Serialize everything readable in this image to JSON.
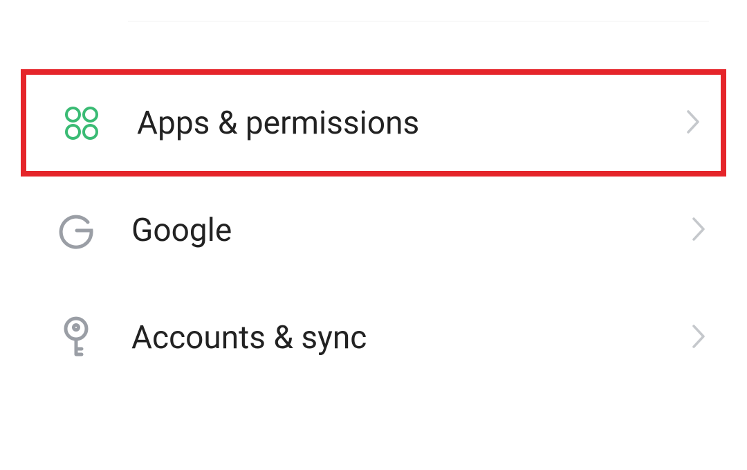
{
  "settings": {
    "items": [
      {
        "id": "apps-permissions",
        "label": "Apps & permissions",
        "icon": "apps-icon",
        "highlighted": true
      },
      {
        "id": "google",
        "label": "Google",
        "icon": "google-icon",
        "highlighted": false
      },
      {
        "id": "accounts-sync",
        "label": "Accounts & sync",
        "icon": "key-icon",
        "highlighted": false
      }
    ]
  },
  "colors": {
    "highlight": "#e5252a",
    "iconGreen": "#3abb74",
    "iconGray": "#9a9ea5",
    "chevron": "#c5c8cc",
    "text": "#222222"
  }
}
